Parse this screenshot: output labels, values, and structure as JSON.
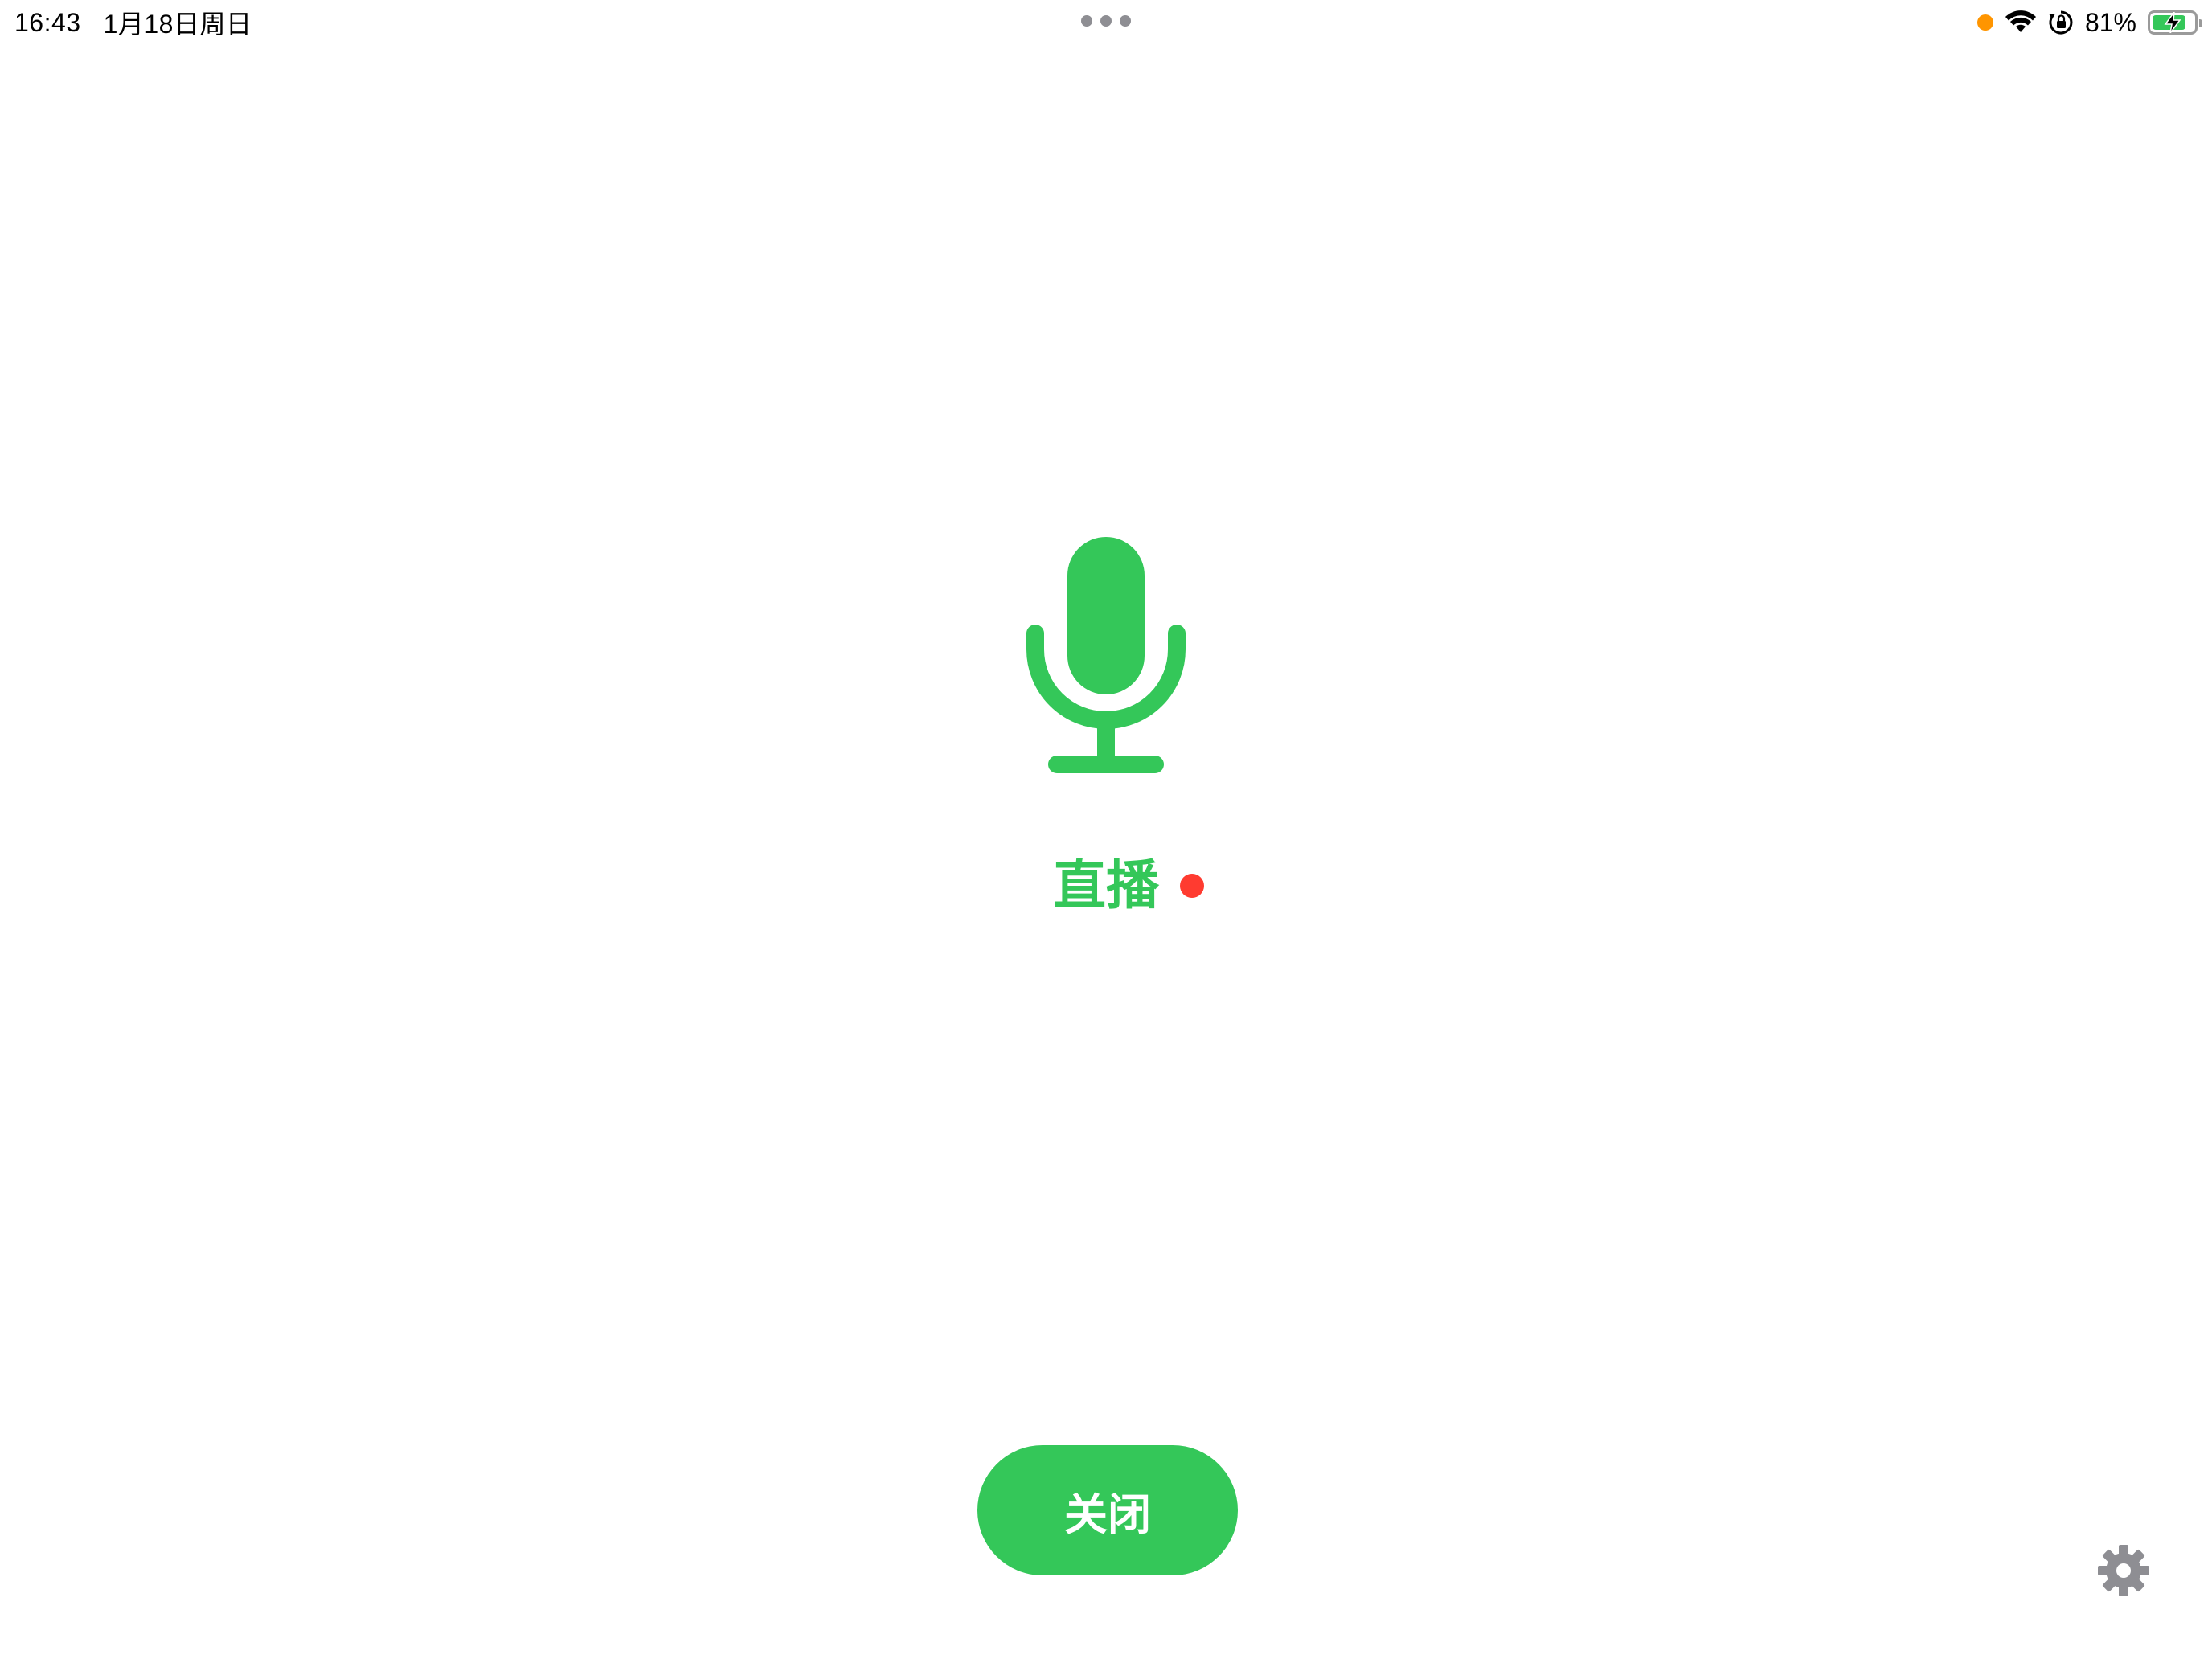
{
  "status_bar": {
    "time": "16:43",
    "date": "1月18日周日",
    "battery_percent": "81%",
    "battery_level": 0.81,
    "privacy_indicator_color": "#FF9500",
    "icons": [
      "wifi-icon",
      "orientation-lock-icon",
      "battery-icon",
      "charging-bolt-icon"
    ]
  },
  "main": {
    "icon": "microphone-icon",
    "status_label": "直播",
    "live_indicator_color": "#FF3B30",
    "close_button_label": "关闭",
    "settings_icon": "gear-icon"
  },
  "colors": {
    "accent": "#34C759",
    "battery_fill": "#34C759",
    "gear": "#8E8E93"
  }
}
